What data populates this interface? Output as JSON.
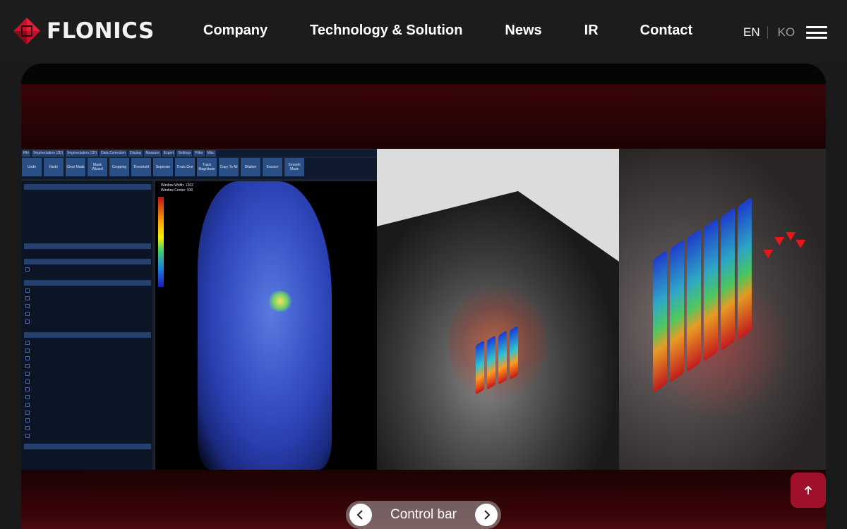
{
  "header": {
    "logo_text": "FLONICS",
    "nav": [
      "Company",
      "Technology & Solution",
      "News",
      "IR",
      "Contact"
    ],
    "lang_en": "EN",
    "lang_ko": "KO",
    "menu_icon": "hamburger-icon"
  },
  "software": {
    "menu": [
      "File",
      "Segmentation (3D)",
      "Segmentation (2D)",
      "Data Correction",
      "Display",
      "Measure",
      "Export",
      "Settings",
      "Filter",
      "Misc"
    ],
    "toolbar": [
      "Undo",
      "Redo",
      "Clear Mask",
      "Mask Wizard",
      "Cropping",
      "Threshold",
      "Seperate",
      "Track One",
      "Track Magnitude",
      "Copy To All",
      "Dilation",
      "Erosion",
      "Smooth Mask"
    ],
    "window_width": "Window Width: 1262",
    "window_center": "Window Center: 930"
  },
  "control_bar": {
    "label": "Control bar",
    "prev_icon": "chevron-left-icon",
    "next_icon": "chevron-right-icon"
  },
  "back_to_top_icon": "arrow-up-icon",
  "colors": {
    "brand_red": "#c8102e",
    "top_button": "#a0102a",
    "header_bg": "#1c1c1c"
  }
}
